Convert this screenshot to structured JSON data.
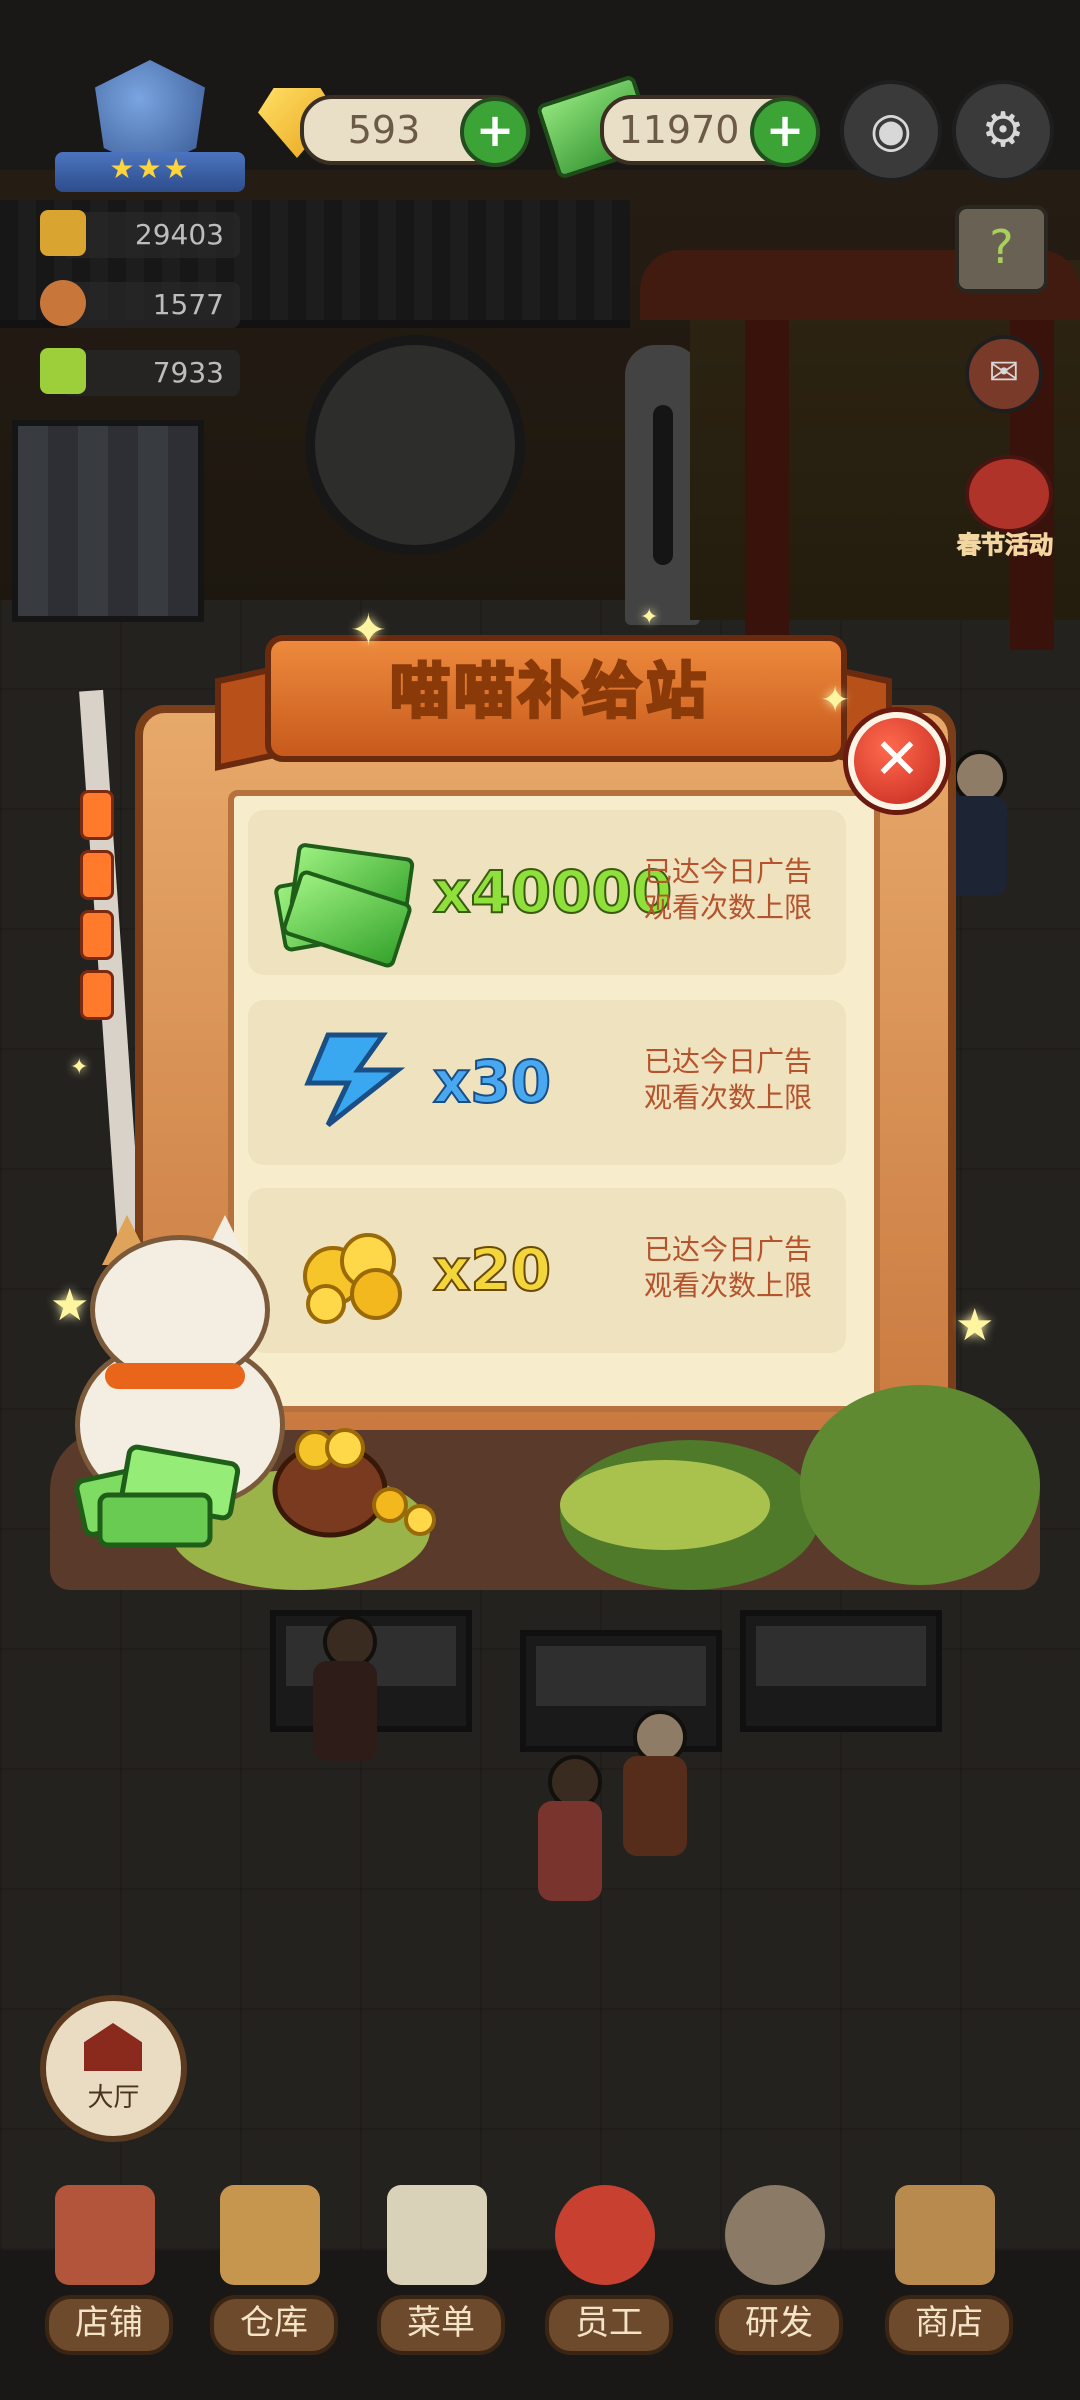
{
  "hud": {
    "gems": "593",
    "cash": "11970",
    "stats": [
      "29403",
      "1577",
      "7933"
    ],
    "event_label": "春节活动"
  },
  "popup": {
    "title": "喵喵补给站",
    "rewards": [
      {
        "icon": "cash-stack-icon",
        "qty": "x40000",
        "status_line1": "已达今日广告",
        "status_line2": "观看次数上限"
      },
      {
        "icon": "lightning-icon",
        "qty": "x30",
        "status_line1": "已达今日广告",
        "status_line2": "观看次数上限"
      },
      {
        "icon": "gold-nuggets-icon",
        "qty": "x20",
        "status_line1": "已达今日广告",
        "status_line2": "观看次数上限"
      }
    ]
  },
  "hall_label": "大厅",
  "nav": [
    "店铺",
    "仓库",
    "菜单",
    "员工",
    "研发",
    "商店"
  ],
  "colors": {
    "accent_green": "#3ca337",
    "title_yellow": "#ffe06a",
    "close_red": "#d43a2a",
    "qty_green": "#8fe03a",
    "qty_blue": "#4aa8f0",
    "qty_yellow": "#f2d63a"
  }
}
